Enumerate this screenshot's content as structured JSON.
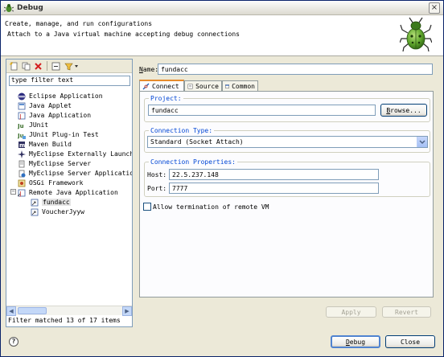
{
  "window": {
    "title": "Debug",
    "close_label": "×"
  },
  "header": {
    "title": "Create, manage, and run configurations",
    "message": "Attach to a Java virtual machine accepting debug connections"
  },
  "left": {
    "filter_value": "type filter text",
    "tree": [
      {
        "label": "Eclipse Application",
        "icon": "eclipse-icon"
      },
      {
        "label": "Java Applet",
        "icon": "applet-icon"
      },
      {
        "label": "Java Application",
        "icon": "java-app-icon"
      },
      {
        "label": "JUnit",
        "icon": "junit-icon"
      },
      {
        "label": "JUnit Plug-in Test",
        "icon": "junit-plugin-icon"
      },
      {
        "label": "Maven Build",
        "icon": "maven-icon"
      },
      {
        "label": "MyEclipse Externally Launched",
        "icon": "myeclipse-external-icon"
      },
      {
        "label": "MyEclipse Server",
        "icon": "server-icon"
      },
      {
        "label": "MyEclipse Server Application",
        "icon": "server-app-icon"
      },
      {
        "label": "OSGi Framework",
        "icon": "osgi-icon"
      },
      {
        "label": "Remote Java Application",
        "icon": "remote-java-icon"
      },
      {
        "label": "fundacc",
        "icon": "remote-config-icon"
      },
      {
        "label": "VoucherJyyw",
        "icon": "remote-config-icon"
      }
    ],
    "status": "Filter matched 13 of 17 items"
  },
  "config": {
    "name_label": "Name:",
    "name_value": "fundacc",
    "tabs": [
      {
        "label": "Connect"
      },
      {
        "label": "Source"
      },
      {
        "label": "Common"
      }
    ],
    "project": {
      "title": "Project:",
      "value": "fundacc",
      "browse_label": "Browse..."
    },
    "connection_type": {
      "title": "Connection Type:",
      "selected": "Standard (Socket Attach)"
    },
    "connection_props": {
      "title": "Connection Properties:",
      "host_label": "Host:",
      "host_value": "22.5.237.148",
      "port_label": "Port:",
      "port_value": "7777"
    },
    "allow_termination_label": "Allow termination of remote VM",
    "apply_label": "Apply",
    "revert_label": "Revert"
  },
  "footer": {
    "help_label": "?",
    "debug_label": "Debug",
    "close_label": "Close"
  },
  "colors": {
    "group_title": "#0046d5",
    "tab_accent": "#e68b2c",
    "border": "#7f9db9"
  }
}
